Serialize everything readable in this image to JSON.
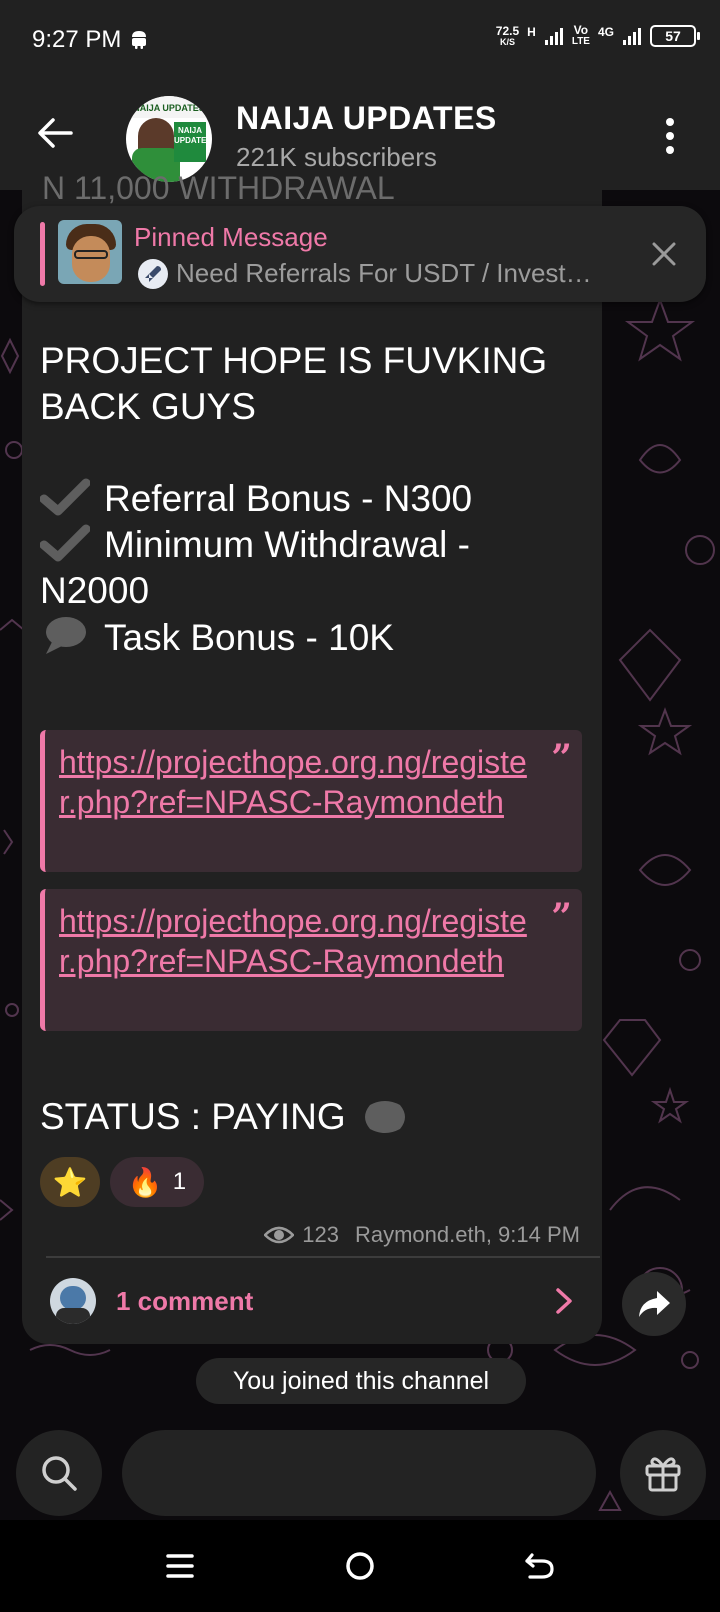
{
  "status_bar": {
    "time": "9:27 PM",
    "speed_value": "72.5",
    "speed_unit": "K/S",
    "net_h": "H",
    "net_volte_top": "Vo",
    "net_volte_bottom": "LTE",
    "net_4g": "4G",
    "battery": "57"
  },
  "header": {
    "avatar_banner": "NAIJA UPDATES",
    "avatar_box": "NAIJA UPDATES",
    "title": "NAIJA UPDATES",
    "subtitle": "221K subscribers"
  },
  "pinned": {
    "title": "Pinned Message",
    "text": "Need Referrals For USDT / Invest…"
  },
  "message": {
    "cut_top": "N 11,000 WITHDRAWAL",
    "heading": "PROJECT HOPE IS FUVKING BACK GUYS",
    "line1": "Referral Bonus - N300",
    "line2a": "Minimum Withdrawal -",
    "line2b": "N2000",
    "line3": "Task Bonus - 10K",
    "quotes": [
      {
        "link": "https://projecthope.org.ng/register.php?ref=NPASC-Raymondeth"
      },
      {
        "link": "https://projecthope.org.ng/register.php?ref=NPASC-Raymondeth"
      }
    ],
    "quote_mark": "”",
    "status": "STATUS : PAYING",
    "reactions": {
      "star": "⭐",
      "fire": "🔥",
      "fire_count": "1"
    },
    "views": "123",
    "signature": "Raymond.eth, 9:14 PM",
    "comments": "1 comment"
  },
  "service": {
    "joined": "You joined this channel"
  },
  "colors": {
    "accent": "#ef79a8",
    "bubble": "#212121",
    "header": "#212121"
  }
}
